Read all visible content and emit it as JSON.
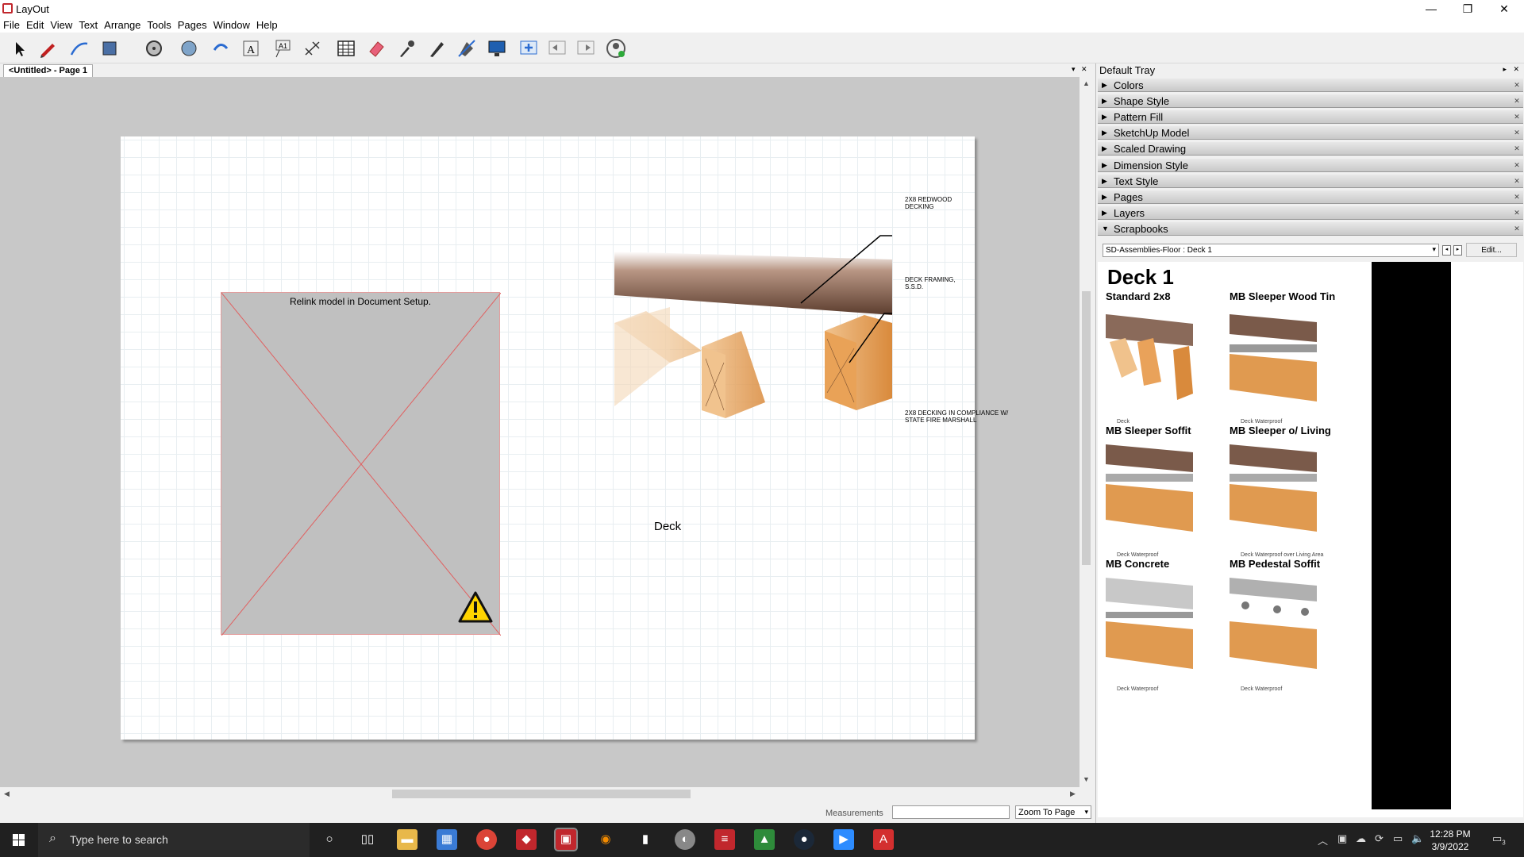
{
  "app": {
    "title": "LayOut"
  },
  "window_controls": {
    "minimize": "—",
    "restore": "❐",
    "close": "✕"
  },
  "menu": [
    "File",
    "Edit",
    "View",
    "Text",
    "Arrange",
    "Tools",
    "Pages",
    "Window",
    "Help"
  ],
  "toolbar": {
    "icons": [
      "select-icon",
      "pencil-icon",
      "line-icon",
      "shape-icon",
      "circle-icon",
      "pie-icon",
      "rotate-icon",
      "text-icon",
      "label-icon",
      "dimension-icon",
      "table-icon",
      "eraser-icon",
      "sample-icon",
      "style-icon",
      "split-icon",
      "present-icon",
      "add-page-icon",
      "prev-page-icon",
      "next-page-icon",
      "account-icon"
    ]
  },
  "document_tab": {
    "label": "<Untitled> - Page 1"
  },
  "canvas": {
    "placeholder_message": "Relink model in Document Setup.",
    "callouts": [
      "2X8 REDWOOD DECKING",
      "DECK FRAMING, S.S.D.",
      "2X8 DECKING IN COMPLIANCE W/ STATE FIRE MARSHALL"
    ],
    "caption": "Deck"
  },
  "status": {
    "measurements_label": "Measurements",
    "measurements_value": "",
    "zoom": "Zoom To Page"
  },
  "tray": {
    "title": "Default Tray",
    "panels": [
      {
        "label": "Colors",
        "expanded": false
      },
      {
        "label": "Shape Style",
        "expanded": false
      },
      {
        "label": "Pattern Fill",
        "expanded": false
      },
      {
        "label": "SketchUp Model",
        "expanded": false
      },
      {
        "label": "Scaled Drawing",
        "expanded": false
      },
      {
        "label": "Dimension Style",
        "expanded": false
      },
      {
        "label": "Text Style",
        "expanded": false
      },
      {
        "label": "Pages",
        "expanded": false
      },
      {
        "label": "Layers",
        "expanded": false
      },
      {
        "label": "Scrapbooks",
        "expanded": true
      }
    ],
    "scrapbook_select": "SD-Assemblies-Floor : Deck 1",
    "edit_label": "Edit...",
    "scrapbook": {
      "heading": "Deck 1",
      "items": [
        {
          "title": "Standard 2x8",
          "caption": "Deck"
        },
        {
          "title": "MB Sleeper Wood Tin",
          "caption": "Deck Waterproof"
        },
        {
          "title": "MB Sleeper Soffit",
          "caption": "Deck Waterproof"
        },
        {
          "title": "MB Sleeper o/ Living",
          "caption": "Deck Waterproof over Living Area"
        },
        {
          "title": "MB Concrete",
          "caption": "Deck Waterproof"
        },
        {
          "title": "MB Pedestal Soffit",
          "caption": "Deck Waterproof"
        }
      ]
    }
  },
  "taskbar": {
    "search_placeholder": "Type here to search",
    "time": "12:28 PM",
    "date": "3/9/2022",
    "notification_count": "3"
  }
}
